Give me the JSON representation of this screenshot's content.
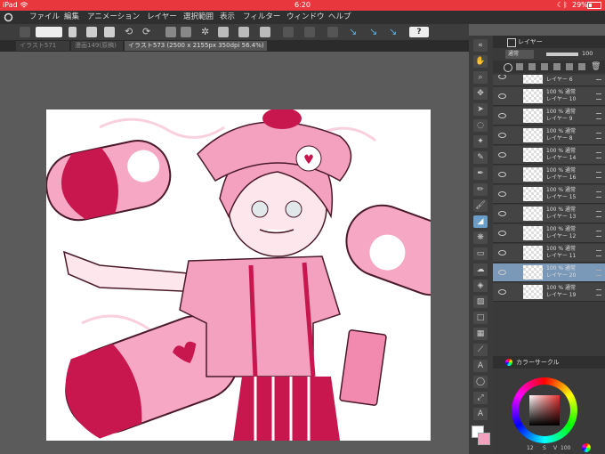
{
  "status": {
    "device": "iPad",
    "time": "6:20",
    "battery": "29%"
  },
  "menu": [
    "ファイル",
    "編集",
    "アニメーション",
    "レイヤー",
    "選択範囲",
    "表示",
    "フィルター",
    "ウィンドウ",
    "ヘルプ"
  ],
  "tabs": [
    {
      "label": "イラスト571",
      "active": false
    },
    {
      "label": "漫画149(原稿)",
      "active": false
    },
    {
      "label": "イラスト573 (2500 x 2155px 350dpi 56.4%)",
      "active": true
    }
  ],
  "help_label": "?",
  "layer_panel": {
    "title": "レイヤー",
    "blend_mode": "通常",
    "opacity": "100",
    "layers": [
      {
        "name": "レイヤー 6",
        "mode": "",
        "selected": false
      },
      {
        "name": "レイヤー 10",
        "mode": "100 % 通常",
        "selected": false
      },
      {
        "name": "レイヤー 9",
        "mode": "100 % 通常",
        "selected": false
      },
      {
        "name": "レイヤー 8",
        "mode": "100 % 通常",
        "selected": false
      },
      {
        "name": "レイヤー 14",
        "mode": "100 % 通常",
        "selected": false
      },
      {
        "name": "レイヤー 16",
        "mode": "100 % 通常",
        "selected": false
      },
      {
        "name": "レイヤー 15",
        "mode": "100 % 通常",
        "selected": false
      },
      {
        "name": "レイヤー 13",
        "mode": "100 % 通常",
        "selected": false
      },
      {
        "name": "レイヤー 12",
        "mode": "100 % 通常",
        "selected": false
      },
      {
        "name": "レイヤー 11",
        "mode": "100 % 通常",
        "selected": false
      },
      {
        "name": "レイヤー 20",
        "mode": "100 % 通常",
        "selected": true
      },
      {
        "name": "レイヤー 19",
        "mode": "100 % 通常",
        "selected": false
      }
    ]
  },
  "color_panel": {
    "title": "カラーサークル",
    "h": "12",
    "s": "S",
    "v": "V",
    "v_value": "100"
  },
  "colors": {
    "status_bar": "#e8383d",
    "accent": "#6a9ec9",
    "layer_selected": "#7a98b8",
    "drawing_pink": "#f4a0bf",
    "drawing_red": "#c8174f"
  }
}
